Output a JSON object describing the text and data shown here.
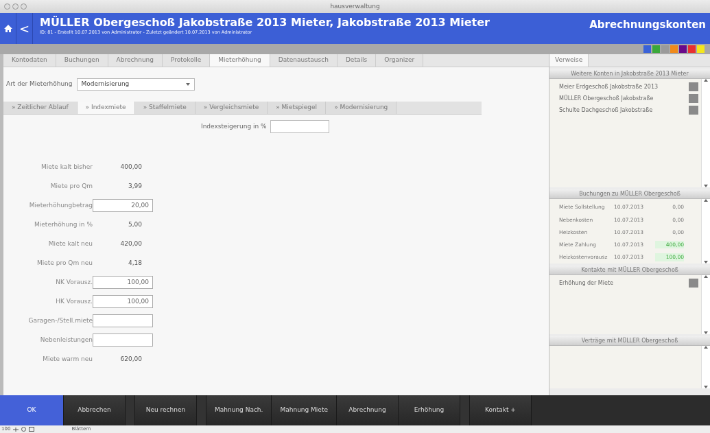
{
  "window": {
    "title": "hausverwaltung"
  },
  "header": {
    "title": "MÜLLER Obergeschoß Jakobstraße 2013 Mieter, Jakobstraße 2013 Mieter",
    "subtitle": "ID: 81 - Erstellt 10.07.2013 von Administrator - Zuletzt geändert 10.07.2013 von Administrator",
    "module": "Abrechnungskonten",
    "back": "<",
    "swatches": [
      {
        "color": "#3a62d8"
      },
      {
        "color": "#3aa83a"
      },
      {
        "color": "#9a9a9a"
      },
      {
        "color": "#f08a1c"
      },
      {
        "color": "#6a0a8a"
      },
      {
        "color": "#e83030"
      },
      {
        "color": "#f4e61c"
      }
    ]
  },
  "tabs": [
    {
      "label": "Kontodaten",
      "selected": false
    },
    {
      "label": "Buchungen",
      "selected": false
    },
    {
      "label": "Abrechnung",
      "selected": false
    },
    {
      "label": "Protokolle",
      "selected": false
    },
    {
      "label": "Mieterhöhung",
      "selected": true
    },
    {
      "label": "Datenaustausch",
      "selected": false
    },
    {
      "label": "Details",
      "selected": false
    },
    {
      "label": "Organizer",
      "selected": false
    }
  ],
  "increase_type": {
    "label": "Art der Mieterhöhung",
    "value": "Modernisierung"
  },
  "subtabs": [
    {
      "label": "» Zeitlicher Ablauf",
      "selected": false
    },
    {
      "label": "» Indexmiete",
      "selected": true
    },
    {
      "label": "» Staffelmiete",
      "selected": false
    },
    {
      "label": "» Vergleichsmiete",
      "selected": false
    },
    {
      "label": "» Mietspiegel",
      "selected": false
    },
    {
      "label": "» Modernisierung",
      "selected": false
    }
  ],
  "index_field": {
    "label": "Indexsteigerung in %"
  },
  "form": [
    {
      "label": "Miete kalt bisher",
      "kind": "value",
      "value": "400,00"
    },
    {
      "label": "Miete pro Qm",
      "kind": "value",
      "value": "3,99"
    },
    {
      "label": "Mieterhöhungbetrag",
      "kind": "input",
      "value": "20,00"
    },
    {
      "label": "Mieterhöhung in %",
      "kind": "value",
      "value": "5,00"
    },
    {
      "label": "Miete kalt neu",
      "kind": "value",
      "value": "420,00"
    },
    {
      "label": "Miete pro Qm neu",
      "kind": "value",
      "value": "4,18"
    },
    {
      "label": "NK Vorausz.",
      "kind": "input",
      "value": "100,00"
    },
    {
      "label": "HK Vorausz.",
      "kind": "input",
      "value": "100,00"
    },
    {
      "label": "Garagen-/Stell.miete",
      "kind": "input"
    },
    {
      "label": "Nebenleistungen",
      "kind": "input"
    },
    {
      "label": "Miete warm neu",
      "kind": "value",
      "value": "620,00"
    }
  ],
  "side_tab": {
    "label": "Verweise",
    "selected": true
  },
  "accounts": {
    "title": "Weitere Konten in Jakobstraße 2013 Mieter",
    "items": [
      "Meier Erdgeschoß Jakobstraße 2013",
      "MÜLLER Obergeschoß Jakobstraße",
      "Schulte Dachgeschoß Jakobstraße"
    ]
  },
  "bookings": {
    "title": "Buchungen zu MÜLLER Obergeschoß",
    "rows": [
      {
        "name": "Miete Sollstellung",
        "date": "10.07.2013",
        "amount": "0,00",
        "paid": false
      },
      {
        "name": "Nebenkosten",
        "date": "10.07.2013",
        "amount": "0,00",
        "paid": false
      },
      {
        "name": "Heizkosten",
        "date": "10.07.2013",
        "amount": "0,00",
        "paid": false
      },
      {
        "name": "Miete Zahlung",
        "date": "10.07.2013",
        "amount": "400,00",
        "paid": true
      },
      {
        "name": "Heizkostenvorausz",
        "date": "10.07.2013",
        "amount": "100,00",
        "paid": true
      }
    ]
  },
  "contacts": {
    "title": "Kontakte mit MÜLLER Obergeschoß",
    "items": [
      "Erhöhung der Miete"
    ]
  },
  "contracts": {
    "title": "Verträge mit MÜLLER Obergeschoß"
  },
  "toolbar": [
    {
      "kind": "primary",
      "label": "OK"
    },
    {
      "kind": "normal",
      "label": "Abbrechen"
    },
    {
      "kind": "spacer"
    },
    {
      "kind": "normal",
      "label": "Neu rechnen"
    },
    {
      "kind": "spacer"
    },
    {
      "kind": "normal",
      "label": "Mahnung Nach."
    },
    {
      "kind": "normal",
      "label": "Mahnung Miete"
    },
    {
      "kind": "normal",
      "label": "Abrechnung"
    },
    {
      "kind": "normal",
      "label": "Erhöhung"
    },
    {
      "kind": "spacer"
    },
    {
      "kind": "normal",
      "label": "Kontakt +"
    }
  ],
  "status_bar": {
    "zoom": "100",
    "mode": "Blättern"
  }
}
